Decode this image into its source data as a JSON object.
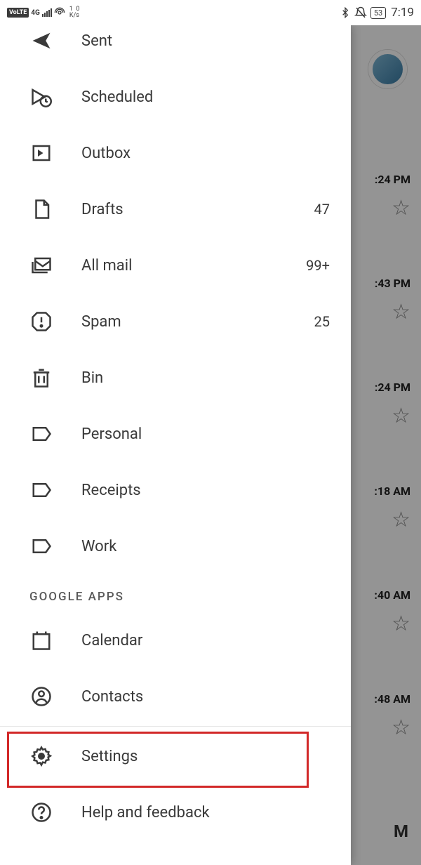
{
  "status_bar": {
    "volte": "VoLTE",
    "net_gen": "4G",
    "speed_top": "1",
    "speed_bottom": "0",
    "speed_unit": "K/s",
    "battery": "53",
    "time": "7:19"
  },
  "drawer": {
    "items_top": [
      {
        "label": "Sent",
        "count": ""
      },
      {
        "label": "Scheduled",
        "count": ""
      },
      {
        "label": "Outbox",
        "count": ""
      },
      {
        "label": "Drafts",
        "count": "47"
      },
      {
        "label": "All mail",
        "count": "99+"
      },
      {
        "label": "Spam",
        "count": "25"
      },
      {
        "label": "Bin",
        "count": ""
      },
      {
        "label": "Personal",
        "count": ""
      },
      {
        "label": "Receipts",
        "count": ""
      },
      {
        "label": "Work",
        "count": ""
      }
    ],
    "section_google_apps": "GOOGLE APPS",
    "items_apps": [
      {
        "label": "Calendar"
      },
      {
        "label": "Contacts"
      }
    ],
    "items_bottom": [
      {
        "label": "Settings"
      },
      {
        "label": "Help and feedback"
      }
    ]
  },
  "inbox_times": [
    ":24 PM",
    ":43 PM",
    ":24 PM",
    ":18 AM",
    ":40 AM",
    ":48 AM"
  ],
  "inbox_tail": "M"
}
